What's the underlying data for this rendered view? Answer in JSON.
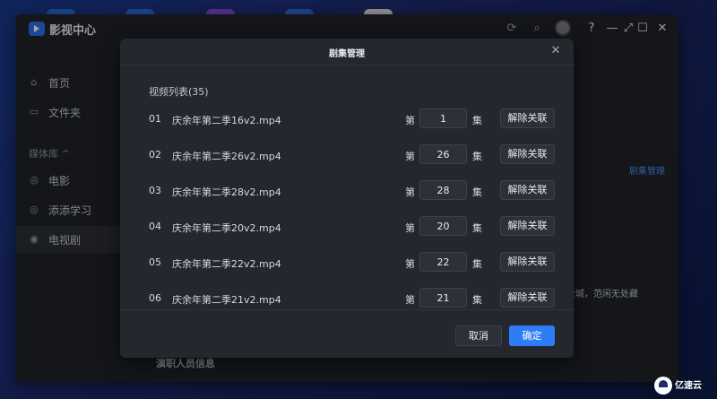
{
  "app": {
    "title": "影视中心"
  },
  "sidebar": {
    "items": [
      {
        "label": "首页",
        "icon": "home-icon"
      },
      {
        "label": "文件夹",
        "icon": "folder-icon"
      }
    ],
    "section_label": "媒体库 ^",
    "library_items": [
      {
        "label": "电影",
        "icon": "movie-icon"
      },
      {
        "label": "添添学习",
        "icon": "study-icon"
      },
      {
        "label": "电视剧",
        "icon": "tv-icon"
      }
    ]
  },
  "background": {
    "episode_manage_link": "剧集管理",
    "desc_fragment": "遍全城，范闲无处藏",
    "cast_heading": "演职人员信息"
  },
  "modal": {
    "title": "剧集管理",
    "list_title": "视频列表(35)",
    "episode_prefix": "第",
    "episode_suffix": "集",
    "unlink_label": "解除关联",
    "rows": [
      {
        "index": "01",
        "filename": "庆余年第二季16v2.mp4",
        "episode": "1"
      },
      {
        "index": "02",
        "filename": "庆余年第二季26v2.mp4",
        "episode": "26"
      },
      {
        "index": "03",
        "filename": "庆余年第二季28v2.mp4",
        "episode": "28"
      },
      {
        "index": "04",
        "filename": "庆余年第二季20v2.mp4",
        "episode": "20"
      },
      {
        "index": "05",
        "filename": "庆余年第二季22v2.mp4",
        "episode": "22"
      },
      {
        "index": "06",
        "filename": "庆余年第二季21v2.mp4",
        "episode": "21"
      }
    ],
    "cancel_label": "取消",
    "confirm_label": "确定"
  },
  "watermark": {
    "line1": "亿速云"
  },
  "colors": {
    "accent": "#2f7df6",
    "dialog_bg": "#24272e",
    "window_bg": "#1f2228"
  }
}
